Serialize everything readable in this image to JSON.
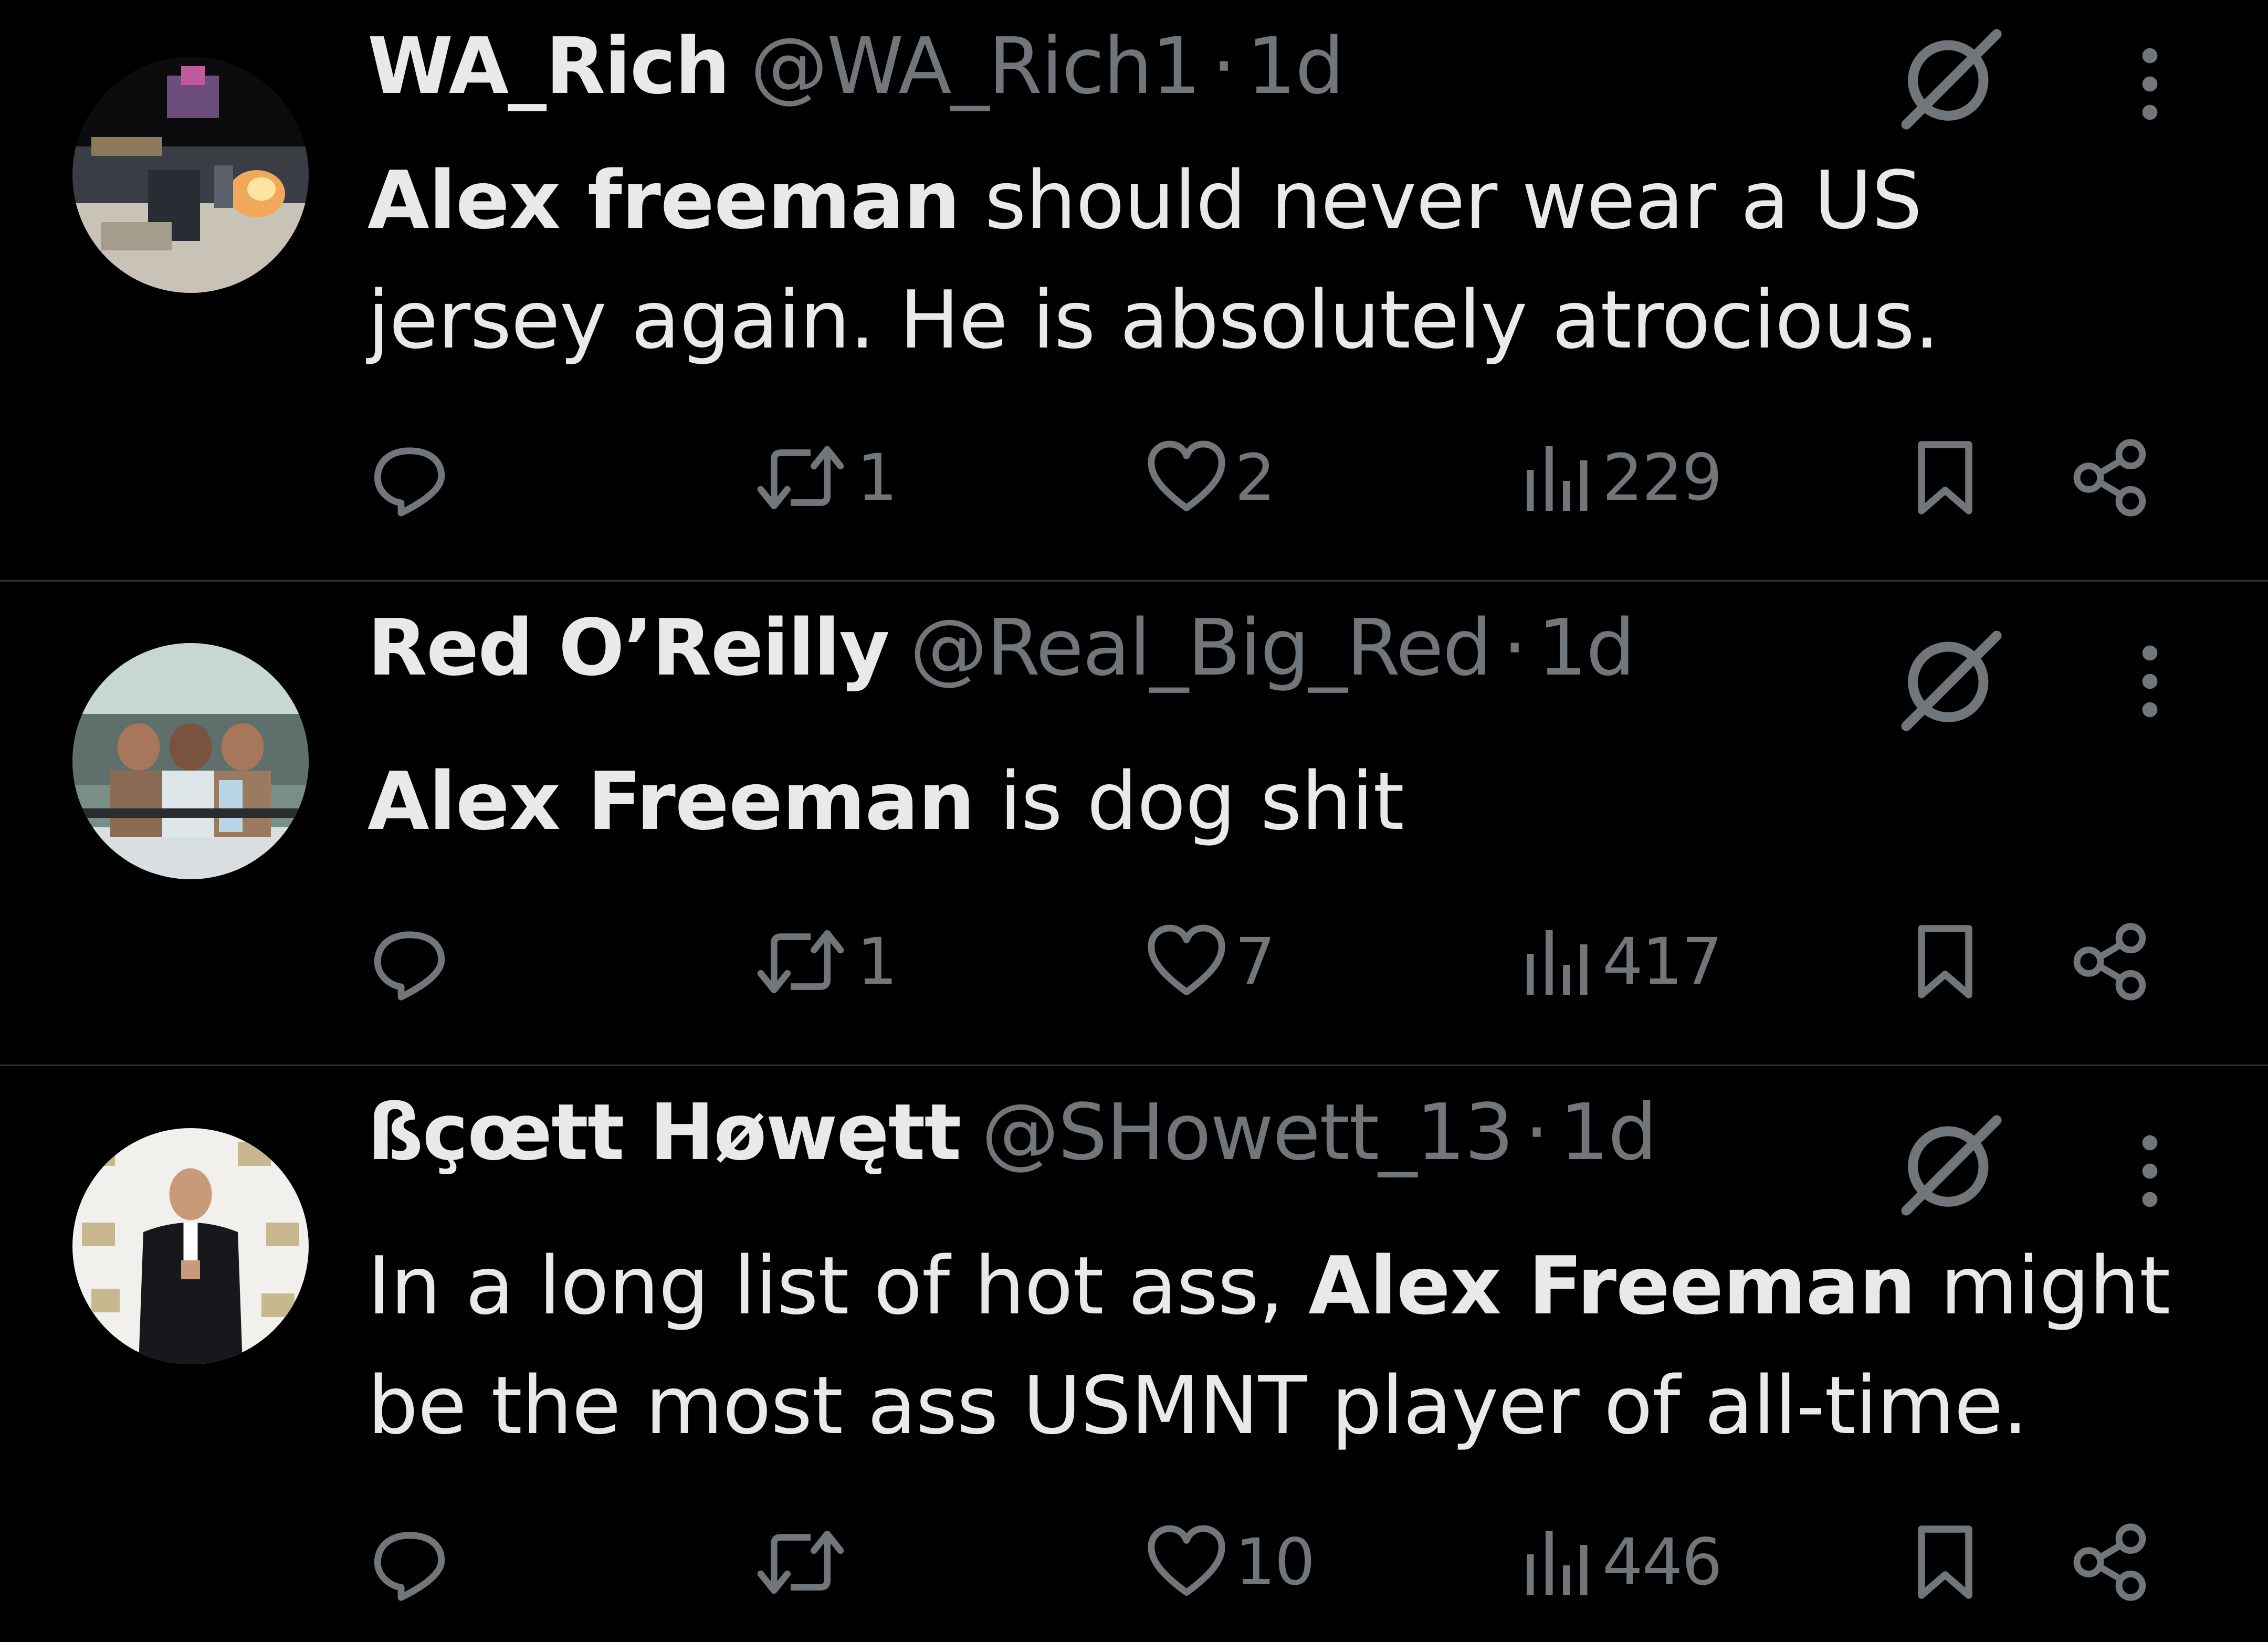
{
  "icons": {
    "reply": "reply-icon",
    "retweet": "retweet-icon",
    "like": "heart-icon",
    "views": "views-icon",
    "bookmark": "bookmark-icon",
    "share": "share-icon",
    "grok": "grok-icon",
    "more": "more-icon"
  },
  "colors": {
    "background": "#000000",
    "text_primary": "#e7e9ea",
    "text_secondary": "#71767b",
    "divider": "#2f3336"
  },
  "tweets": [
    {
      "name": "WA_Rich",
      "handle": "@WA_Rich1",
      "separator": "·",
      "time": "1d",
      "body": [
        {
          "text": "Alex freeman",
          "bold": true
        },
        {
          "text": " should never wear a US jersey again. He is absolutely atrocious.",
          "bold": false
        }
      ],
      "replies": "",
      "retweets": "1",
      "likes": "2",
      "views": "229"
    },
    {
      "name": "Red O’Reilly",
      "handle": "@Real_Big_Red",
      "separator": "·",
      "time": "1d",
      "body": [
        {
          "text": "Alex Freeman",
          "bold": true
        },
        {
          "text": " is dog shit",
          "bold": false
        }
      ],
      "replies": "",
      "retweets": "1",
      "likes": "7",
      "views": "417"
    },
    {
      "name": "ßçœtt Høwętt",
      "handle": "@SHowett_13",
      "separator": "·",
      "time": "1d",
      "body": [
        {
          "text": "In a long list of hot ass, ",
          "bold": false
        },
        {
          "text": "Alex Freeman",
          "bold": true
        },
        {
          "text": " might be the most ass USMNT player of all-time.",
          "bold": false
        }
      ],
      "replies": "",
      "retweets": "",
      "likes": "10",
      "views": "446"
    }
  ]
}
